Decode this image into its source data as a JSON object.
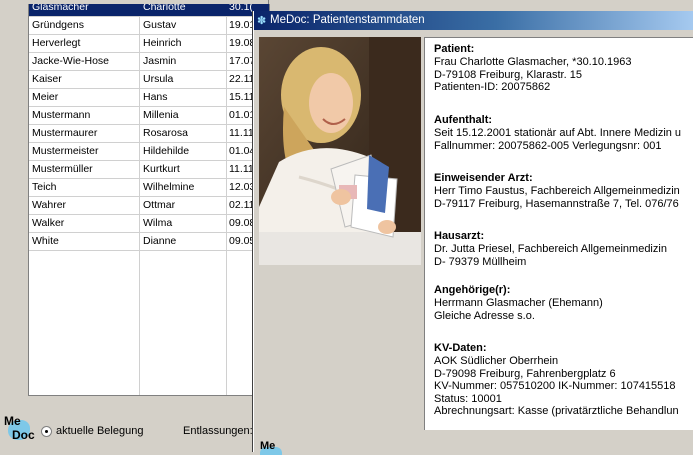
{
  "list": {
    "rows": [
      {
        "last": "Glasmacher",
        "first": "Charlotte",
        "date": "30.1(",
        "selected": true
      },
      {
        "last": "Gründgens",
        "first": "Gustav",
        "date": "19.01"
      },
      {
        "last": "Herverlegt",
        "first": "Heinrich",
        "date": "19.08"
      },
      {
        "last": "Jacke-Wie-Hose",
        "first": "Jasmin",
        "date": "17.07"
      },
      {
        "last": "Kaiser",
        "first": "Ursula",
        "date": "22.11"
      },
      {
        "last": "Meier",
        "first": "Hans",
        "date": "15.11"
      },
      {
        "last": "Mustermann",
        "first": "Millenia",
        "date": "01.01"
      },
      {
        "last": "Mustermaurer",
        "first": "Rosarosa",
        "date": "11.11"
      },
      {
        "last": "Mustermeister",
        "first": "Hildehilde",
        "date": "01.04"
      },
      {
        "last": "Mustermüller",
        "first": "Kurtkurt",
        "date": "11.11"
      },
      {
        "last": "Teich",
        "first": "Wilhelmine",
        "date": "12.03"
      },
      {
        "last": "Wahrer",
        "first": "Ottmar",
        "date": "02.11"
      },
      {
        "last": "Walker",
        "first": "Wilma",
        "date": "09.08"
      },
      {
        "last": "White",
        "first": "Dianne",
        "date": "09.05"
      }
    ],
    "logo_me": "Me",
    "logo_doc": "Doc",
    "radio_label": "aktuelle Belegung",
    "discharge_label": "Entlassungen:"
  },
  "detail": {
    "title": "MeDoc: Patientenstammdaten",
    "logo_me": "Me",
    "sections": [
      {
        "heading": "Patient:",
        "lines": [
          "Frau Charlotte Glasmacher, *30.10.1963",
          "D-79108 Freiburg, Klarastr. 15",
          "Patienten-ID: 20075862"
        ]
      },
      {
        "heading": "Aufenthalt:",
        "lines": [
          "Seit 15.12.2001 stationär auf Abt. Innere Medizin u",
          "Fallnummer: 20075862-005 Verlegungsnr: 001"
        ]
      },
      {
        "heading": "Einweisender Arzt:",
        "lines": [
          "Herr Timo Faustus, Fachbereich Allgemeinmedizin",
          "D-79117 Freiburg, Hasemannstraße 7, Tel. 076/76"
        ]
      },
      {
        "heading": "Hausarzt:",
        "lines": [
          "Dr. Jutta Priesel, Fachbereich Allgemeinmedizin",
          "D- 79379 Müllheim"
        ]
      },
      {
        "heading": "Angehörige(r):",
        "lines": [
          "Herrmann Glasmacher (Ehemann)",
          "Gleiche Adresse s.o."
        ]
      },
      {
        "heading": "KV-Daten:",
        "lines": [
          "AOK Südlicher Oberrhein",
          "D-79098 Freiburg, Fahrenbergplatz 6",
          "KV-Nummer: 057510200  IK-Nummer: 107415518",
          "Status: 10001",
          "Abrechnungsart: Kasse (privatärztliche Behandlun"
        ]
      }
    ]
  }
}
